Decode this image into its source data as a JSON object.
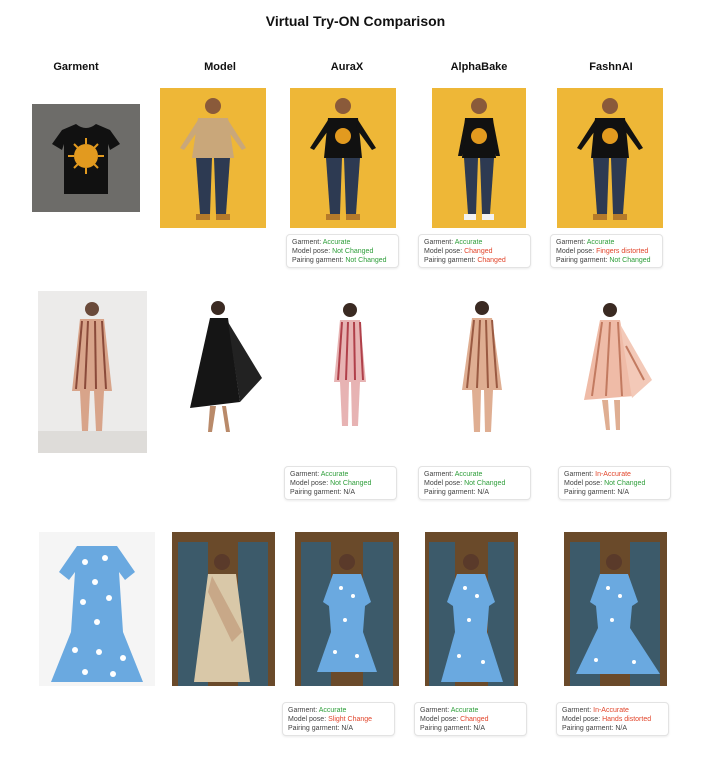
{
  "title": "Virtual Try-ON Comparison",
  "columns": [
    "Garment",
    "Model",
    "AuraX",
    "AlphaBake",
    "FashnAI"
  ],
  "colors": {
    "good": "#2e9e3a",
    "bad": "#e2452b",
    "yellow_bg": "#eeb737",
    "studio_bg": "#6a4a2a"
  },
  "rows": [
    {
      "cards": [
        {
          "garment_label": "Garment:",
          "garment": "Accurate",
          "garment_status": "good",
          "pose_label": "Model pose:",
          "pose": "Not Changed",
          "pose_status": "good",
          "pairing_label": "Pairing garment:",
          "pairing": "Not Changed",
          "pairing_status": "good"
        },
        {
          "garment_label": "Garment:",
          "garment": "Accurate",
          "garment_status": "good",
          "pose_label": "Model pose:",
          "pose": "Changed",
          "pose_status": "bad",
          "pairing_label": "Pairing garment:",
          "pairing": "Changed",
          "pairing_status": "bad"
        },
        {
          "garment_label": "Garment:",
          "garment": "Accurate",
          "garment_status": "good",
          "pose_label": "Model pose:",
          "pose": "Fingers distorted",
          "pose_status": "bad",
          "pairing_label": "Pairing garment:",
          "pairing": "Not Changed",
          "pairing_status": "good"
        }
      ]
    },
    {
      "cards": [
        {
          "garment_label": "Garment:",
          "garment": "Accurate",
          "garment_status": "good",
          "pose_label": "Model pose:",
          "pose": "Not Changed",
          "pose_status": "good",
          "pairing_label": "Pairing garment:",
          "pairing": "N/A",
          "pairing_status": "neutral"
        },
        {
          "garment_label": "Garment:",
          "garment": "Accurate",
          "garment_status": "good",
          "pose_label": "Model pose:",
          "pose": "Not Changed",
          "pose_status": "good",
          "pairing_label": "Pairing garment:",
          "pairing": "N/A",
          "pairing_status": "neutral"
        },
        {
          "garment_label": "Garment:",
          "garment": "In-Accurate",
          "garment_status": "bad",
          "pose_label": "Model pose:",
          "pose": "Not Changed",
          "pose_status": "good",
          "pairing_label": "Pairing garment:",
          "pairing": "N/A",
          "pairing_status": "neutral"
        }
      ]
    },
    {
      "cards": [
        {
          "garment_label": "Garment:",
          "garment": "Accurate",
          "garment_status": "good",
          "pose_label": "Model pose:",
          "pose": "Slight Change",
          "pose_status": "bad",
          "pairing_label": "Pairing garment:",
          "pairing": "N/A",
          "pairing_status": "neutral"
        },
        {
          "garment_label": "Garment:",
          "garment": "Accurate",
          "garment_status": "good",
          "pose_label": "Model pose:",
          "pose": "Changed",
          "pose_status": "bad",
          "pairing_label": "Pairing garment:",
          "pairing": "N/A",
          "pairing_status": "neutral"
        },
        {
          "garment_label": "Garment:",
          "garment": "In-Accurate",
          "garment_status": "bad",
          "pose_label": "Model pose:",
          "pose": "Hands distorted",
          "pose_status": "bad",
          "pairing_label": "Pairing garment:",
          "pairing": "N/A",
          "pairing_status": "neutral"
        }
      ]
    }
  ]
}
